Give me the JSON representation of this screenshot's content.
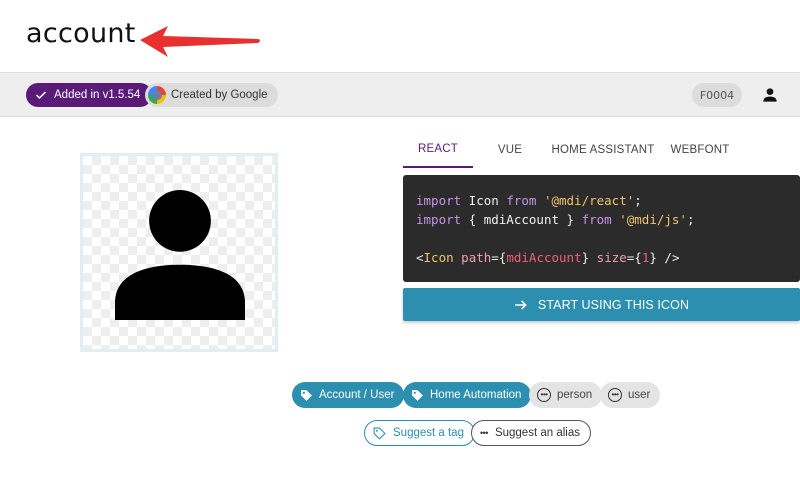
{
  "header": {
    "title": "account"
  },
  "infobar": {
    "added_label": "Added in v1.5.54",
    "created_label": "Created by Google",
    "codepoint": "F0004"
  },
  "tabs": [
    {
      "label": "REACT",
      "active": true
    },
    {
      "label": "VUE",
      "active": false
    },
    {
      "label": "HOME ASSISTANT",
      "active": false
    },
    {
      "label": "WEBFONT",
      "active": false
    }
  ],
  "code": {
    "line1": {
      "kw1": "import",
      "plain1": " Icon ",
      "kw2": "from",
      "str": " '@mdi/react'",
      "end": ";"
    },
    "line2": {
      "kw1": "import",
      "plain1": " { mdiAccount } ",
      "kw2": "from",
      "str": " '@mdi/js'",
      "end": ";"
    },
    "line3": {
      "open": "<",
      "tag": "Icon",
      "attr1": " path",
      "eq1": "={",
      "val1": "mdiAccount",
      "close1": "}",
      "attr2": " size",
      "eq2": "={",
      "val2": "1",
      "close2": "}",
      "end": " />"
    }
  },
  "start_button": {
    "label": "START USING THIS ICON"
  },
  "tags": [
    {
      "label": "Account / User"
    },
    {
      "label": "Home Automation"
    }
  ],
  "aliases": [
    {
      "label": "person"
    },
    {
      "label": "user"
    }
  ],
  "suggest": {
    "tag_label": "Suggest a tag",
    "alias_label": "Suggest an alias"
  },
  "colors": {
    "accent_purple": "#5a1a78",
    "accent_blue": "#2c8faf",
    "annotation_arrow": "#e8302f",
    "code_bg": "#2b2b2b"
  }
}
